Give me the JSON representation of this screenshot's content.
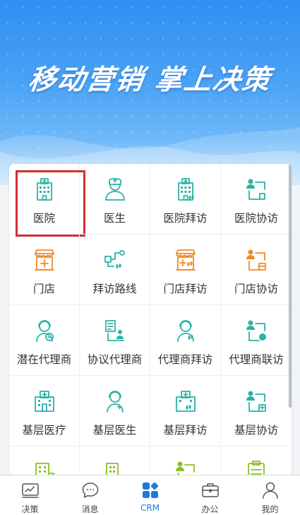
{
  "banner": {
    "slogan": "移动营销 掌上决策"
  },
  "grid": [
    {
      "label": "医院",
      "icon": "hospital-icon",
      "color": "#2ab3a6"
    },
    {
      "label": "医生",
      "icon": "doctor-icon",
      "color": "#2ab3a6"
    },
    {
      "label": "医院拜访",
      "icon": "hospital-visit-icon",
      "color": "#2ab3a6"
    },
    {
      "label": "医院协访",
      "icon": "hospital-assist-visit-icon",
      "color": "#2ab3a6"
    },
    {
      "label": "门店",
      "icon": "store-icon",
      "color": "#f08a24"
    },
    {
      "label": "拜访路线",
      "icon": "visit-route-icon",
      "color": "#2ab3a6"
    },
    {
      "label": "门店拜访",
      "icon": "store-visit-icon",
      "color": "#f08a24"
    },
    {
      "label": "门店协访",
      "icon": "store-assist-visit-icon",
      "color": "#f08a24"
    },
    {
      "label": "潜在代理商",
      "icon": "potential-agent-icon",
      "color": "#2ab3a6"
    },
    {
      "label": "协议代理商",
      "icon": "contract-agent-icon",
      "color": "#2ab3a6"
    },
    {
      "label": "代理商拜访",
      "icon": "agent-visit-icon",
      "color": "#2ab3a6"
    },
    {
      "label": "代理商联访",
      "icon": "agent-joint-visit-icon",
      "color": "#2ab3a6"
    },
    {
      "label": "基层医疗",
      "icon": "clinic-icon",
      "color": "#2ab3a6"
    },
    {
      "label": "基层医生",
      "icon": "clinic-doctor-icon",
      "color": "#2ab3a6"
    },
    {
      "label": "基层拜访",
      "icon": "clinic-visit-icon",
      "color": "#2ab3a6"
    },
    {
      "label": "基层协访",
      "icon": "clinic-assist-visit-icon",
      "color": "#2ab3a6"
    },
    {
      "label": "",
      "icon": "building-icon",
      "color": "#8cbf26"
    },
    {
      "label": "",
      "icon": "building-chart-icon",
      "color": "#8cbf26"
    },
    {
      "label": "",
      "icon": "person-report-icon",
      "color": "#8cbf26"
    },
    {
      "label": "",
      "icon": "checklist-icon",
      "color": "#8cbf26"
    }
  ],
  "tabbar": [
    {
      "label": "决策",
      "icon": "trend-chart-icon"
    },
    {
      "label": "消息",
      "icon": "chat-bubble-icon"
    },
    {
      "label": "CRM",
      "icon": "crm-grid-icon",
      "active": true
    },
    {
      "label": "办公",
      "icon": "briefcase-icon"
    },
    {
      "label": "我的",
      "icon": "user-icon"
    }
  ],
  "colors": {
    "accent": "#1f78e0",
    "teal": "#2ab3a6",
    "orange": "#f08a24",
    "green": "#8cbf26",
    "highlight": "#d32f2f"
  }
}
